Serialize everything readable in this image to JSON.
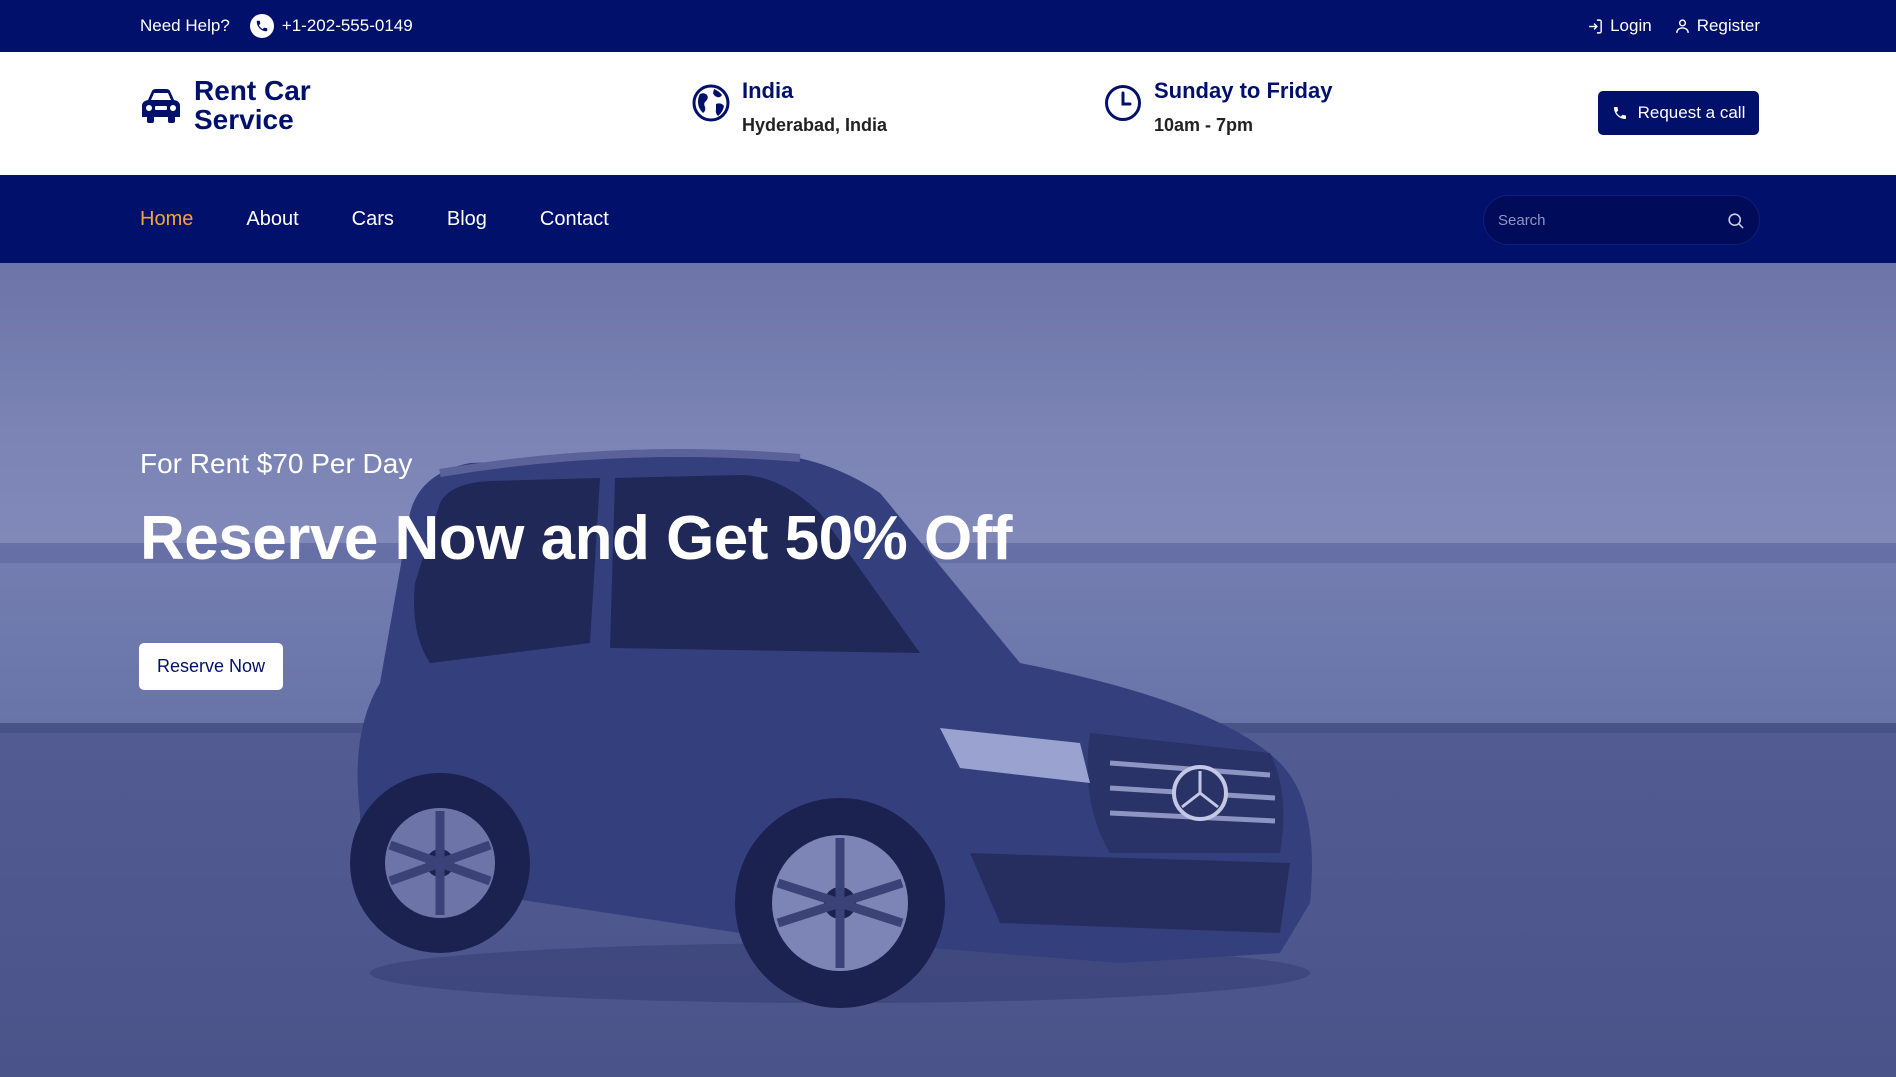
{
  "topbar": {
    "help_label": "Need Help?",
    "phone": "+1-202-555-0149",
    "login_label": "Login",
    "register_label": "Register"
  },
  "header": {
    "logo_text": "Rent Car Service",
    "location": {
      "title": "India",
      "subtitle": "Hyderabad, India"
    },
    "hours": {
      "title": "Sunday to Friday",
      "subtitle": "10am - 7pm"
    },
    "call_button": "Request a call"
  },
  "nav": {
    "items": [
      {
        "label": "Home",
        "active": true
      },
      {
        "label": "About"
      },
      {
        "label": "Cars"
      },
      {
        "label": "Blog"
      },
      {
        "label": "Contact"
      }
    ],
    "search_placeholder": "Search"
  },
  "hero": {
    "subtitle": "For Rent $70 Per Day",
    "title": "Reserve Now and Get 50% Off",
    "button": "Reserve Now"
  },
  "colors": {
    "brand": "#00106b",
    "accent": "#f5a33a"
  },
  "icons": [
    "phone-icon",
    "login-icon",
    "user-icon",
    "car-icon",
    "globe-icon",
    "clock-icon",
    "search-icon"
  ]
}
